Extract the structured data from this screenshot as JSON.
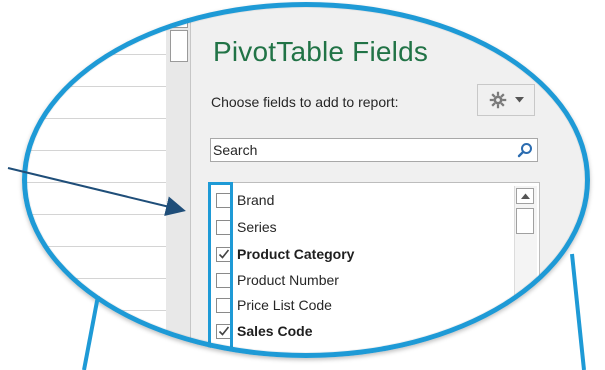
{
  "pane": {
    "title": "PivotTable Fields",
    "subtitle": "Choose fields to add to report:",
    "search_placeholder": "Search"
  },
  "fields": [
    {
      "label": "Brand",
      "checked": false
    },
    {
      "label": "Series",
      "checked": false
    },
    {
      "label": "Product Category",
      "checked": true
    },
    {
      "label": "Product Number",
      "checked": false
    },
    {
      "label": "Price List Code",
      "checked": false
    },
    {
      "label": "Sales Code",
      "checked": true
    }
  ],
  "colors": {
    "accent": "#1e9ad6",
    "title_green": "#217346",
    "pane_bg": "#f0f0f0"
  },
  "icons": {
    "settings": "gear-icon",
    "dropdown": "chevron-down-icon",
    "search": "search-icon",
    "scroll_up": "scroll-up-arrow-icon",
    "check": "checkmark-icon"
  }
}
